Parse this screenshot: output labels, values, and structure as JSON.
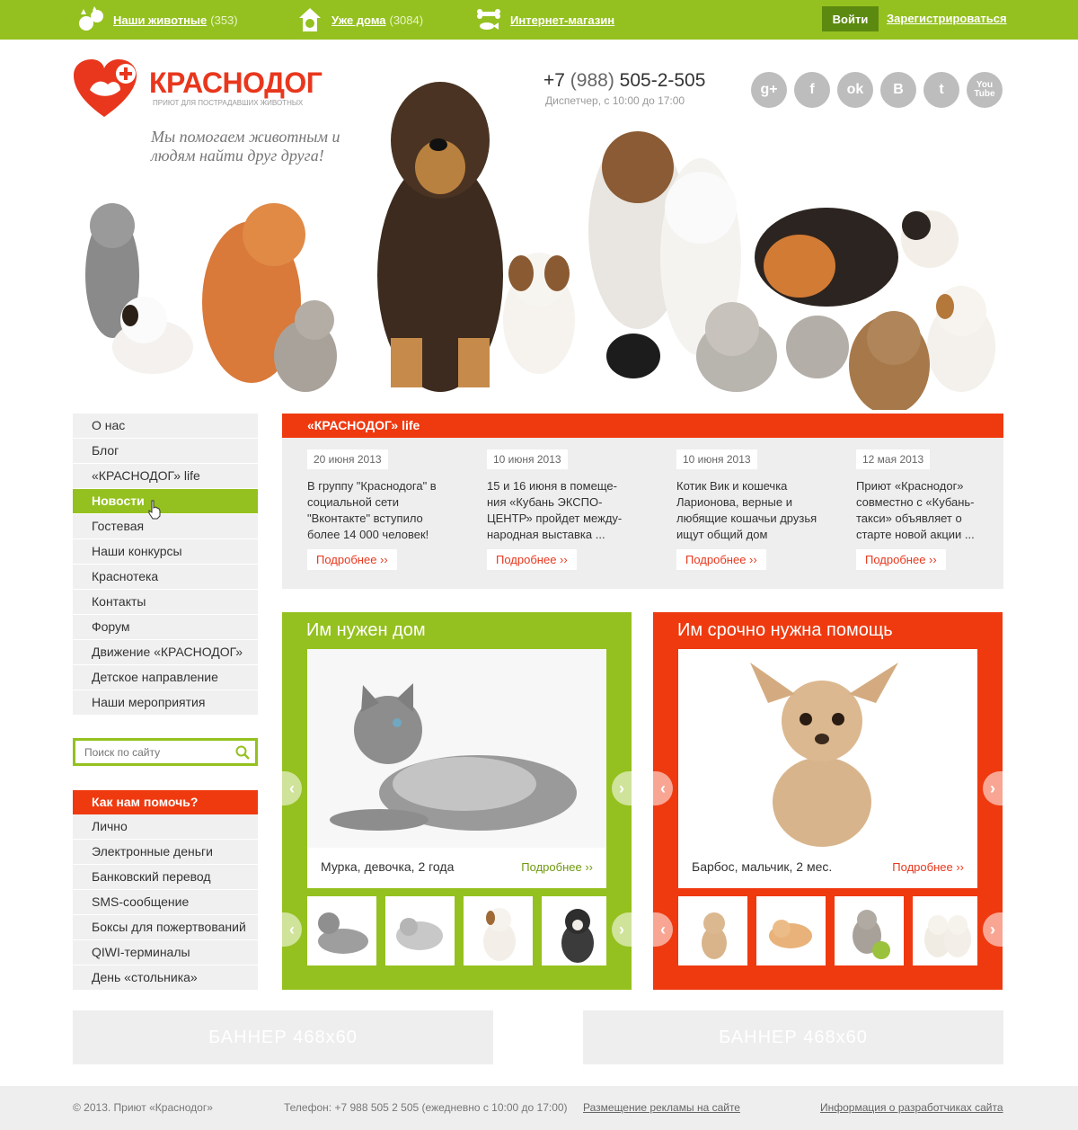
{
  "topbar": {
    "animals_label": "Наши животные",
    "animals_count": "(353)",
    "home_label": "Уже дома",
    "home_count": "(3084)",
    "shop_label": "Интернет-магазин",
    "login_label": "Войти",
    "register_label": "Зарегистрироваться"
  },
  "header": {
    "logo_name": "КРАСНОДОГ",
    "logo_sub": "ПРИЮТ ДЛЯ ПОСТРАДАВШИХ ЖИВОТНЫХ",
    "tagline": "Мы помогаем животным и людям найти друг друга!",
    "phone_prefix": "+7",
    "phone_code": "(988)",
    "phone_number": "505-2-505",
    "phone_note": "Диспетчер, с 10:00 до 17:00",
    "socials": [
      "g+",
      "f",
      "ok",
      "B",
      "t",
      "You Tube"
    ]
  },
  "menu": {
    "items": [
      "О нас",
      "Блог",
      "«КРАСНОДОГ» life",
      "Новости",
      "Гостевая",
      "Наши конкурсы",
      "Краснотека",
      "Контакты",
      "Форум",
      "Движение «КРАСНОДОГ»",
      "Детское направление",
      "Наши мероприятия"
    ],
    "active": "Новости"
  },
  "search": {
    "placeholder": "Поиск по сайту"
  },
  "help": {
    "title": "Как нам помочь?",
    "items": [
      "Лично",
      "Электронные деньги",
      "Банковский перевод",
      "SMS-сообщение",
      "Боксы для пожертвований",
      "QIWI-терминалы",
      "День «стольника»"
    ]
  },
  "news": {
    "title": "«КРАСНОДОГ» life",
    "more_label": "Подробнее ››",
    "items": [
      {
        "date": "20 июня 2013",
        "text": "В группу \"Краснодога\" в социальной сети \"Вконтакте\" вступило более 14 000 человек!"
      },
      {
        "date": "10 июня 2013",
        "text": "15 и 16 июня в помеще-ния «Кубань ЭКСПО-ЦЕНТР» пройдет между-народная выставка ..."
      },
      {
        "date": "10 июня 2013",
        "text": "Котик Вик и кошечка Ларионова, верные и любящие кошачьи друзья ищут общий дом"
      },
      {
        "date": "12 мая 2013",
        "text": "Приют «Краснодог» совместно с «Кубань-такси» объявляет о старте новой акции ..."
      }
    ]
  },
  "panels": {
    "home": {
      "title": "Им нужен дом",
      "caption": "Мурка, девочка, 2 года",
      "more": "Подробнее ››"
    },
    "urgent": {
      "title": "Им срочно нужна помощь",
      "caption": "Барбос, мальчик, 2 мес.",
      "more": "Подробнее ››"
    }
  },
  "banners": [
    "БАННЕР  468х60",
    "БАННЕР  468х60"
  ],
  "footer": {
    "copyright": "© 2013. Приют «Краснодог»",
    "phone": "Телефон: +7 988 505 2 505 (ежедневно с 10:00 до 17:00)",
    "ads": "Размещение рекламы на сайте",
    "developers": "Информация о разработчиках сайта"
  },
  "colors": {
    "green": "#94c11f",
    "red": "#ef3a10",
    "grey": "#eeeeee"
  }
}
